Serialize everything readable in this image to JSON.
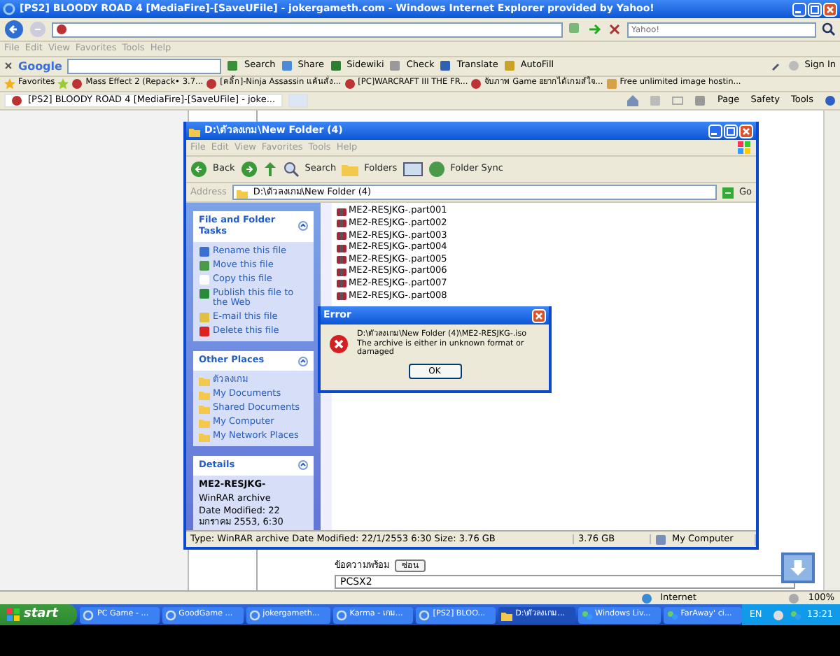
{
  "ie": {
    "title": "[PS2] BLOODY ROAD 4 [MediaFire]-[SaveUFile] - jokergameth.com - Windows Internet Explorer provided by Yahoo!",
    "search_placeholder": "Yahoo!",
    "menu": [
      "File",
      "Edit",
      "View",
      "Favorites",
      "Tools",
      "Help"
    ],
    "google_toolbar": {
      "logo": "Google",
      "buttons": [
        "Search",
        "Share",
        "Sidewiki",
        "Check",
        "Translate",
        "AutoFill"
      ],
      "sign_in": "Sign In"
    },
    "favorites_label": "Favorites",
    "favorites": [
      "Mass Effect 2 (Repack• 3.7...",
      "[คลิ้ก]-Ninja Assassin แค้นสั่ง...",
      "[PC]WARCRAFT III  THE FR...",
      "จับภาพ Game อยากได้เกมส์ใจ...",
      "Free unlimited image hostin..."
    ],
    "tab": "[PS2] BLOODY ROAD 4 [MediaFire]-[SaveUFile] - joke...",
    "command_bar": [
      "Page",
      "Safety",
      "Tools"
    ],
    "page": {
      "label": "ข้อความพร้อม",
      "button": "ซ่อน",
      "textarea_value": "PCSX2"
    },
    "status_bar": {
      "zone": "Internet",
      "zoom": "100%"
    }
  },
  "explorer": {
    "title": "D:\\ตัวลงเกม\\New Folder (4)",
    "menu": [
      "File",
      "Edit",
      "View",
      "Favorites",
      "Tools",
      "Help"
    ],
    "toolbar": [
      "Back",
      "Search",
      "Folders",
      "Folder Sync"
    ],
    "address_label": "Address",
    "address": "D:\\ตัวลงเกม\\New Folder (4)",
    "go": "Go",
    "panes": [
      {
        "kind": "tasks",
        "title": "File and Folder Tasks",
        "items": [
          "Rename this file",
          "Move this file",
          "Copy this file",
          "Publish this file to the Web",
          "E-mail this file",
          "Delete this file"
        ]
      },
      {
        "kind": "places",
        "title": "Other Places",
        "items": [
          "ตัวลงเกม",
          "My Documents",
          "Shared Documents",
          "My Computer",
          "My Network Places"
        ]
      },
      {
        "kind": "details",
        "title": "Details",
        "name": "ME2-RESJKG-",
        "type": "WinRAR archive",
        "date": "Date Modified: 22 มกราคม 2553, 6:30"
      }
    ],
    "files": [
      "ME2-RESJKG-.part001",
      "ME2-RESJKG-.part002",
      "ME2-RESJKG-.part003",
      "ME2-RESJKG-.part004",
      "ME2-RESJKG-.part005",
      "ME2-RESJKG-.part006",
      "ME2-RESJKG-.part007",
      "ME2-RESJKG-.part008"
    ],
    "status_bar": {
      "info": "Type: WinRAR archive Date Modified: 22/1/2553 6:30 Size: 3.76 GB",
      "size": "3.76 GB",
      "location": "My Computer"
    }
  },
  "error_dialog": {
    "title": "Error",
    "path": "D:\\ตัวลงเกม\\New Folder (4)\\ME2-RESJKG-.iso",
    "message": "The archive is either in unknown format or damaged",
    "button": "OK"
  },
  "taskbar": {
    "start": "start",
    "items": [
      {
        "label": "PC Game - ...",
        "kind": "ie",
        "selected": false
      },
      {
        "label": "GoodGame ...",
        "kind": "ie",
        "selected": false
      },
      {
        "label": "jokergameth...",
        "kind": "ie",
        "selected": false
      },
      {
        "label": "Karma - เกม...",
        "kind": "ie",
        "selected": false
      },
      {
        "label": "[PS2] BLOO...",
        "kind": "ie",
        "selected": false
      },
      {
        "label": "D:\\ตัวลงเกม...",
        "kind": "folder",
        "selected": true
      },
      {
        "label": "Windows Liv...",
        "kind": "messenger",
        "selected": false
      },
      {
        "label": "FarAway' ci...",
        "kind": "messenger",
        "selected": false
      }
    ],
    "language": "EN",
    "clock": "13:21"
  }
}
